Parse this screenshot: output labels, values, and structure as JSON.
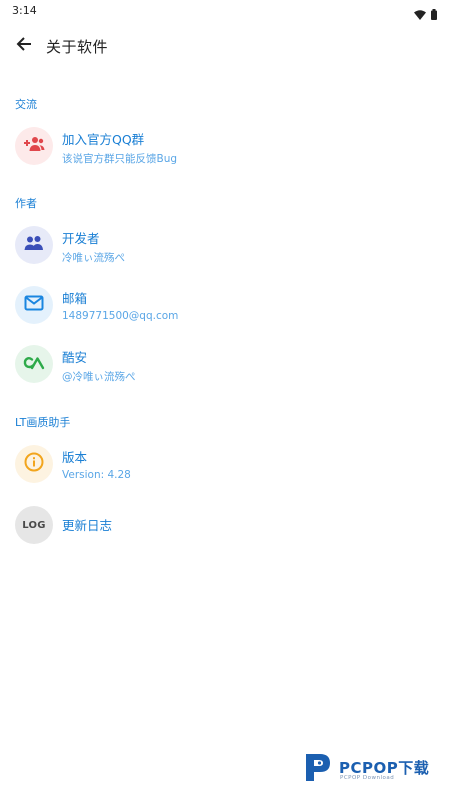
{
  "status_bar": {
    "time": "3:14",
    "icons": [
      "wifi-icon",
      "battery-icon"
    ]
  },
  "app_bar": {
    "back_icon": "arrow-left-icon",
    "title": "关于软件"
  },
  "sections": [
    {
      "label": "交流",
      "items": [
        {
          "icon": "add-group-icon",
          "title": "加入官方QQ群",
          "subtitle": "该说官方群只能反馈Bug",
          "icon_color": "#e0474c",
          "icon_bg": "#fdeaea"
        }
      ]
    },
    {
      "label": "作者",
      "items": [
        {
          "icon": "people-icon",
          "title": "开发者",
          "subtitle": "冷唯ぃ流殇ぺ",
          "icon_color": "#3b4fb8",
          "icon_bg": "#e7eaf8"
        },
        {
          "icon": "mail-icon",
          "title": "邮箱",
          "subtitle": "1489771500@qq.com",
          "icon_color": "#1a86e0",
          "icon_bg": "#e4f1fc"
        },
        {
          "icon": "coolapk-icon",
          "title": "酷安",
          "subtitle": "@冷唯ぃ流殇ぺ",
          "icon_color": "#2eaa4a",
          "icon_bg": "#e6f5ea"
        }
      ]
    },
    {
      "label": "LT画质助手",
      "items": [
        {
          "icon": "info-icon",
          "title": "版本",
          "subtitle": "Version: 4.28",
          "icon_color": "#f2a51d",
          "icon_bg": "#fdf3e1"
        },
        {
          "icon": "log-icon",
          "title": "更新日志",
          "subtitle": "",
          "icon_color": "#4a4a4a",
          "icon_bg": "#e6e6e6",
          "icon_text": "LOG"
        }
      ]
    }
  ],
  "watermark": {
    "text": "PCPOP下载",
    "subtext": "PCPOP Download",
    "color": "#1b5fb0"
  }
}
